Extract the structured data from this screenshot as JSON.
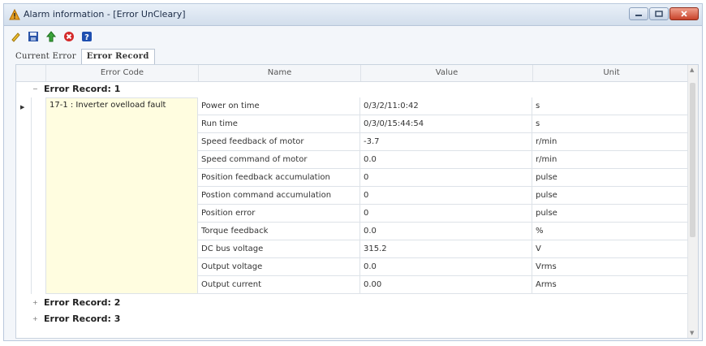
{
  "window": {
    "title": "Alarm information - [Error UnCleary]"
  },
  "tabs": {
    "current_error": "Current Error",
    "error_record": "Error Record"
  },
  "columns": {
    "error_code": "Error Code",
    "name": "Name",
    "value": "Value",
    "unit": "Unit"
  },
  "records": [
    {
      "label": "Error Record: 1",
      "expanded": true
    },
    {
      "label": "Error Record: 2",
      "expanded": false
    },
    {
      "label": "Error Record: 3",
      "expanded": false
    }
  ],
  "record1": {
    "error_code": "17-1 : Inverter ovelload fault",
    "rows": [
      {
        "name": "Power on time",
        "value": "0/3/2/11:0:42",
        "unit": "s"
      },
      {
        "name": "Run time",
        "value": "0/3/0/15:44:54",
        "unit": "s"
      },
      {
        "name": "Speed feedback of motor",
        "value": "-3.7",
        "unit": "r/min"
      },
      {
        "name": "Speed command of motor",
        "value": "0.0",
        "unit": "r/min"
      },
      {
        "name": "Position feedback accumulation",
        "value": "0",
        "unit": "pulse"
      },
      {
        "name": "Postion command accumulation",
        "value": "0",
        "unit": "pulse"
      },
      {
        "name": "Position error",
        "value": "0",
        "unit": "pulse"
      },
      {
        "name": "Torque feedback",
        "value": "0.0",
        "unit": "%"
      },
      {
        "name": "DC bus voltage",
        "value": "315.2",
        "unit": "V"
      },
      {
        "name": "Output voltage",
        "value": "0.0",
        "unit": "Vrms"
      },
      {
        "name": "Output current",
        "value": "0.00",
        "unit": "Arms"
      }
    ]
  },
  "colors": {
    "accent": "#b7c6d9",
    "highlight_cell": "#fffde0"
  },
  "icons": {
    "title": "warning-icon",
    "toolbar": [
      "edit-icon",
      "save-icon",
      "upload-icon",
      "stop-icon",
      "help-icon"
    ]
  }
}
